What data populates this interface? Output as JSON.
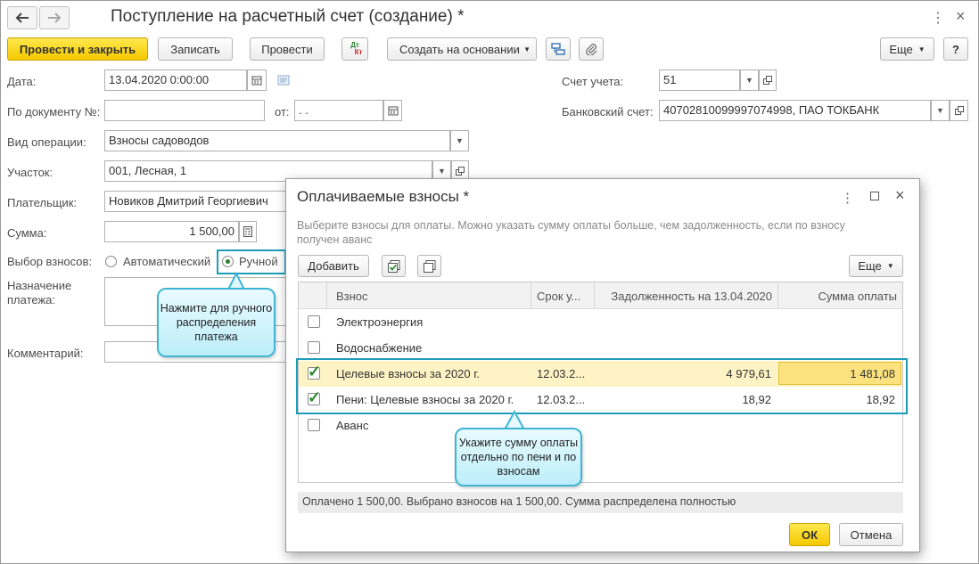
{
  "window": {
    "title": "Поступление на расчетный счет (создание) *",
    "back_icon": "arrow-left-icon",
    "forward_icon": "arrow-right-icon",
    "menu_icon": "more-vertical-icon",
    "close_icon": "close-icon"
  },
  "toolbar": {
    "post_close": "Провести и закрыть",
    "save": "Записать",
    "post": "Провести",
    "dtkt_top": "Дт",
    "dtkt_bottom": "Кт",
    "create_based": "Создать на основании",
    "more": "Еще",
    "help": "?"
  },
  "form": {
    "date_label": "Дата:",
    "date_value": "13.04.2020  0:00:00",
    "doc_no_label": "По документу №:",
    "doc_no_value": "",
    "from_label": "от:",
    "from_value": " .  .",
    "operation_label": "Вид операции:",
    "operation_value": "Взносы садоводов",
    "plot_label": "Участок:",
    "plot_value": "001, Лесная, 1",
    "payer_label": "Плательщик:",
    "payer_value": "Новиков Дмитрий Георгиевич",
    "sum_label": "Сумма:",
    "sum_value": "1 500,00",
    "choice_label": "Выбор взносов:",
    "choice_auto": "Автоматический",
    "choice_manual": "Ручной",
    "purpose_label_1": "Назначение",
    "purpose_label_2": "платежа:",
    "comment_label": "Комментарий:",
    "account_label": "Счет учета:",
    "account_value": "51",
    "bank_label": "Банковский счет:",
    "bank_value": "40702810099997074998, ПАО ТОКБАНК"
  },
  "callout_manual": "Нажмите для ручного распределения платежа",
  "callout_separately": "Укажите сумму оплаты отдельно по пени и по взносам",
  "dialog": {
    "title": "Оплачиваемые взносы *",
    "hint": "Выберите взносы для оплаты. Можно указать сумму оплаты больше, чем задолженность, если по взносу получен аванс",
    "add": "Добавить",
    "more": "Еще",
    "columns": {
      "name": "Взнос",
      "due": "Срок у...",
      "debt": "Задолженность на 13.04.2020",
      "pay": "Сумма оплаты"
    },
    "rows": [
      {
        "checked": false,
        "name": "Электроэнергия",
        "due": "",
        "debt": "",
        "pay": ""
      },
      {
        "checked": false,
        "name": "Водоснабжение",
        "due": "",
        "debt": "",
        "pay": ""
      },
      {
        "checked": true,
        "name": "Целевые взносы за 2020 г.",
        "due": "12.03.2...",
        "debt": "4 979,61",
        "pay": "1 481,08"
      },
      {
        "checked": true,
        "name": "Пени: Целевые взносы за 2020 г.",
        "due": "12.03.2...",
        "debt": "18,92",
        "pay": "18,92"
      },
      {
        "checked": false,
        "name": "Аванс",
        "due": "",
        "debt": "",
        "pay": ""
      }
    ],
    "status": "Оплачено 1 500,00. Выбрано взносов на 1 500,00. Сумма распределена полностью",
    "ok": "ОК",
    "cancel": "Отмена"
  },
  "colors": {
    "accent_yellow": "#f5c900",
    "highlight_border": "#1e9cb8",
    "selected_row": "#fdf3c4",
    "callout_fill": "#bdeef9"
  }
}
